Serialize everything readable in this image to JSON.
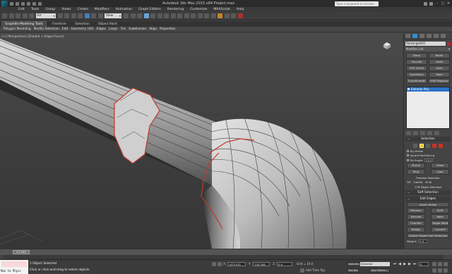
{
  "titlebar": {
    "title": "Autodesk 3ds Max 2015 x64    Project.max",
    "search_placeholder": "Type a keyword or phrase"
  },
  "menu": [
    "Edit",
    "Tools",
    "Group",
    "Views",
    "Create",
    "Modifiers",
    "Animation",
    "Graph Editors",
    "Rendering",
    "Customize",
    "MAXScript",
    "Help"
  ],
  "toolbar": {
    "selection_filter": "All",
    "reference_coord": "View"
  },
  "ribbon": {
    "tabs": [
      "Graphite Modeling Tools",
      "Freeform",
      "Selection",
      "Object Paint"
    ],
    "active_tab": "Graphite Modeling Tools",
    "subtabs": [
      "Polygon Modeling",
      "Modify Selection",
      "Edit",
      "Geometry (All)",
      "Edges",
      "Loops",
      "Tris",
      "Subdivision",
      "Align",
      "Properties"
    ]
  },
  "viewport": {
    "label": "[+] [Perspective] [Shaded + Edged Faces]"
  },
  "command_panel": {
    "object_name": "Rectangle001",
    "modifier_list": "Modifier List",
    "modifier_buttons": [
      "Bend",
      "Bevel",
      "Extrude",
      "Lathe",
      "FFD 3x3x3",
      "Shell",
      "Symmetry",
      "Taper",
      "TurboSmooth",
      "UVW Mapping Cle"
    ],
    "stack_item": "Editable Poly",
    "selection": {
      "title": "Selection",
      "by_vertex": "By Vertex",
      "ignore_backfacing": "Ignore Backfacing",
      "by_angle": "By Angle:",
      "by_angle_value": "45.0",
      "shrink": "Shrink",
      "grow": "Grow",
      "ring": "Ring",
      "loop": "Loop",
      "preview_selection": "Preview Selection",
      "preview_off": "Off",
      "preview_subobj": "SubObj",
      "preview_multi": "Multi",
      "status": "176 Edges Selected"
    },
    "soft_selection": "Soft Selection",
    "edit_edges": {
      "title": "Edit Edges",
      "insert_vertex": "Insert Vertex",
      "remove": "Remove",
      "split": "Split",
      "extrude": "Extrude",
      "weld": "Weld",
      "chamfer": "Chamfer",
      "target_weld": "Target Weld",
      "bridge": "Bridge",
      "connect": "Connect",
      "create_shape": "Create Shape From Selection",
      "weight_label": "Weight:",
      "weight_value": "1.0"
    }
  },
  "timeline": {
    "slider": "0 / 100"
  },
  "status": {
    "maxscript": "Max to Physc",
    "objects_selected": "1 Object Selected",
    "prompt": "Click or click-and-drag to select objects",
    "x_label": "X:",
    "x_value": "-673.031",
    "y_label": "Y:",
    "y_value": "134.306",
    "z_label": "Z:",
    "z_value": "0.0",
    "grid": "Grid = 10.0",
    "add_time_tag": "Add Time Tag",
    "auto_key": "Auto Key",
    "selected": "Selected",
    "set_key": "Set Key",
    "key_filters": "Key Filters...",
    "frame": "0"
  }
}
